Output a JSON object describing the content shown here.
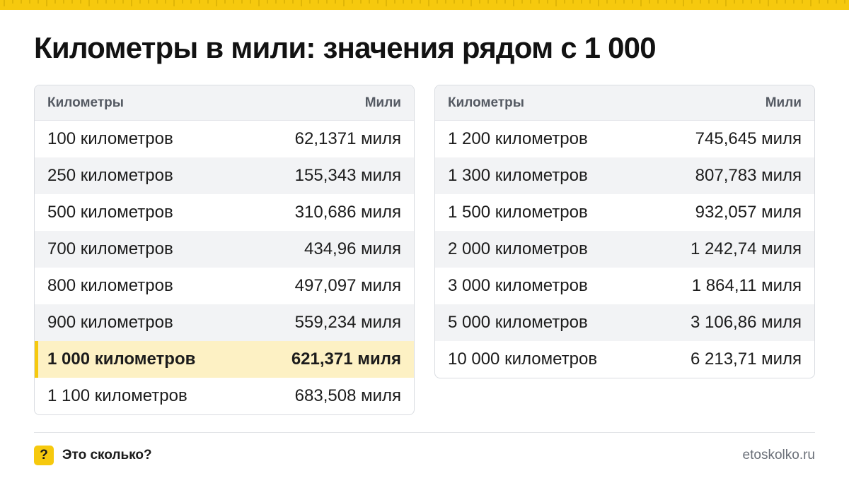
{
  "title": "Километры в мили: значения рядом с 1 000",
  "colors": {
    "accent": "#f6c90e",
    "highlight_row": "#fdf1c4",
    "header_bg": "#f2f3f5",
    "border": "#d9dce1"
  },
  "left_table": {
    "headers": {
      "km": "Километры",
      "mi": "Мили"
    },
    "rows": [
      {
        "km": "100 километров",
        "mi": "62,1371 миля"
      },
      {
        "km": "250 километров",
        "mi": "155,343 миля"
      },
      {
        "km": "500 километров",
        "mi": "310,686 миля"
      },
      {
        "km": "700 километров",
        "mi": "434,96 миля"
      },
      {
        "km": "800 километров",
        "mi": "497,097 миля"
      },
      {
        "km": "900 километров",
        "mi": "559,234 миля"
      },
      {
        "km": "1 000 километров",
        "mi": "621,371 миля"
      },
      {
        "km": "1 100 километров",
        "mi": "683,508 миля"
      }
    ],
    "highlighted_row": 6
  },
  "right_table": {
    "headers": {
      "km": "Километры",
      "mi": "Мили"
    },
    "rows": [
      {
        "km": "1 200 километров",
        "mi": "745,645 миля"
      },
      {
        "km": "1 300 километров",
        "mi": "807,783 миля"
      },
      {
        "km": "1 500 километров",
        "mi": "932,057 миля"
      },
      {
        "km": "2 000 километров",
        "mi": "1 242,74 миля"
      },
      {
        "km": "3 000 километров",
        "mi": "1 864,11 миля"
      },
      {
        "km": "5 000 километров",
        "mi": "3 106,86 миля"
      },
      {
        "km": "10 000 километров",
        "mi": "6 213,71 миля"
      }
    ]
  },
  "footer": {
    "icon_glyph": "?",
    "icon_name": "question-icon",
    "brand": "Это сколько?",
    "site": "etoskolko.ru"
  }
}
